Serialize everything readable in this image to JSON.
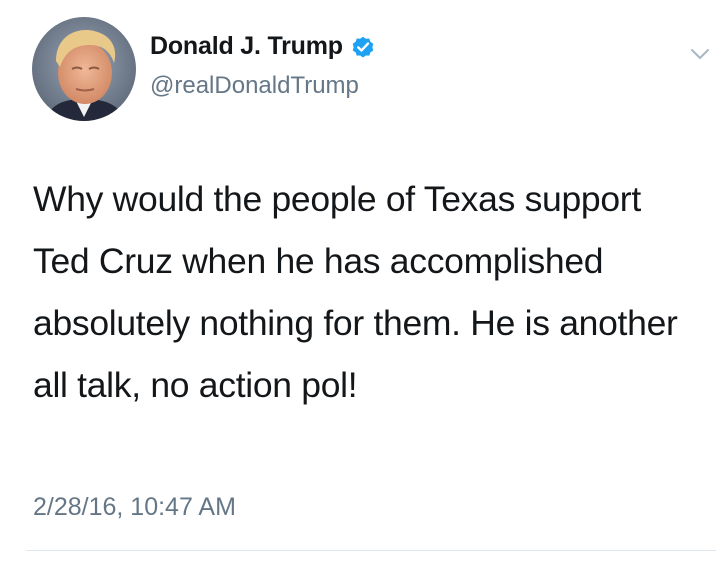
{
  "author": {
    "display_name": "Donald J. Trump",
    "handle": "@realDonaldTrump",
    "verified": true,
    "verified_icon": "verified-badge-icon",
    "avatar_icon": "profile-avatar"
  },
  "tweet": {
    "text": "Why would the people of Texas support Ted Cruz when he has accomplished absolutely nothing for them. He is another all talk, no action pol!",
    "timestamp": "2/28/16, 10:47 AM"
  },
  "menu": {
    "icon": "chevron-down-icon"
  },
  "colors": {
    "text": "#14171a",
    "secondary": "#657786",
    "verified_blue": "#1da1f2",
    "divider": "#e1e8ed"
  }
}
